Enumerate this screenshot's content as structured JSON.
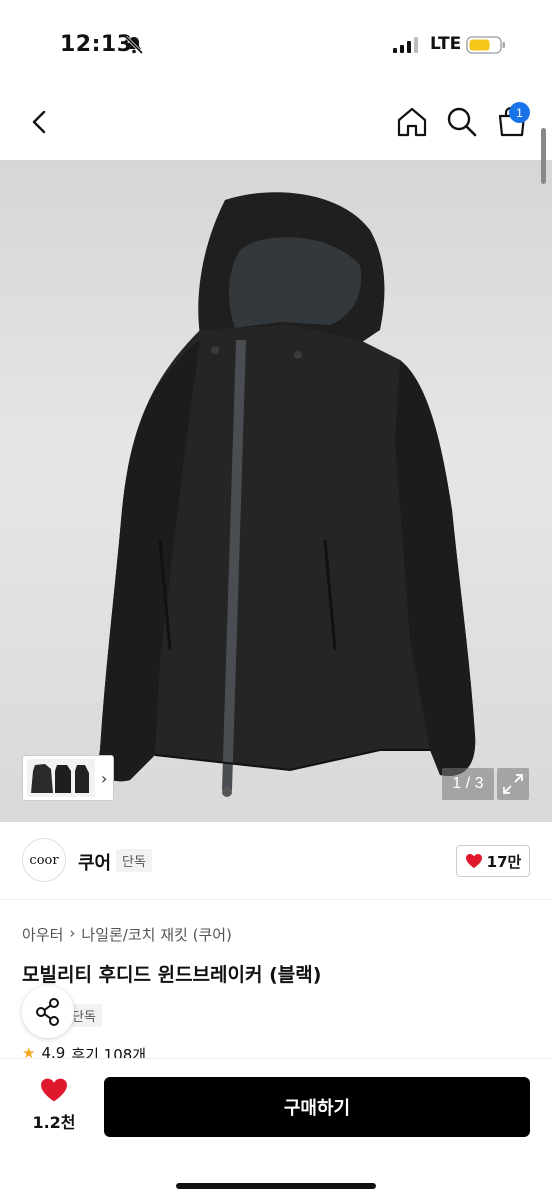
{
  "status_bar": {
    "time": "12:13",
    "network": "LTE",
    "battery_color": "#f5c518"
  },
  "header": {
    "cart_count": "1"
  },
  "gallery": {
    "counter": "1 / 3",
    "thumb_arrow": "›"
  },
  "brand": {
    "logo_text": "coor",
    "name": "쿠어",
    "tag": "단독",
    "likes": "17만"
  },
  "product": {
    "breadcrumb": [
      "아우터",
      "나일론/코치 재킷 (쿠어)"
    ],
    "breadcrumb_separator": "›",
    "title": "모빌리티 후디드 윈드브레이커 (블랙)",
    "exclusive_tag": "단독",
    "rating": "4.9",
    "reviews": "후기 108개"
  },
  "bottom_bar": {
    "wish_count": "1.2천",
    "buy_label": "구매하기"
  },
  "colors": {
    "accent_badge": "#1a73e8",
    "heart": "#e0182d",
    "buy_button": "#000000"
  }
}
